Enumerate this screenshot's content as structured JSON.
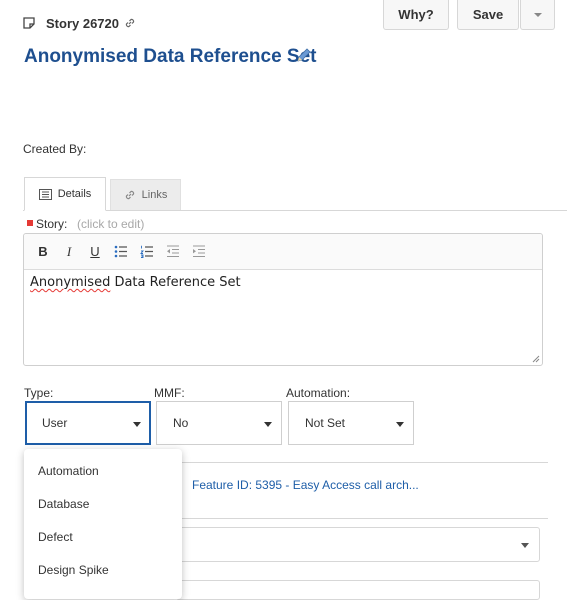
{
  "header": {
    "story_id": "Story 26720",
    "title": "Anonymised Data Reference Set",
    "why_label": "Why?",
    "save_label": "Save"
  },
  "meta": {
    "created_by_label": "Created By:"
  },
  "tabs": [
    {
      "label": "Details",
      "icon": "details-icon",
      "active": true
    },
    {
      "label": "Links",
      "icon": "link-icon",
      "active": false
    }
  ],
  "story_field": {
    "label": "Story:",
    "hint": "(click to edit)",
    "text_misspelled": "Anonymised",
    "text_rest": " Data Reference Set",
    "toolbar": {
      "bold": "B",
      "italic": "I",
      "underline": "U"
    }
  },
  "fields": {
    "type": {
      "label": "Type:",
      "value": "User"
    },
    "mmf": {
      "label": "MMF:",
      "value": "No"
    },
    "automation": {
      "label": "Automation:",
      "value": "Not Set"
    }
  },
  "feature_link": "Feature ID: 5395 - Easy Access call arch...",
  "background_select_fragment": "l",
  "type_dropdown": {
    "options": [
      "Automation",
      "Database",
      "Defect",
      "Design Spike"
    ]
  },
  "colors": {
    "title": "#1e4f8f",
    "link": "#1e5ea8",
    "required": "#e53935",
    "focus_border": "#1e5ea8"
  }
}
